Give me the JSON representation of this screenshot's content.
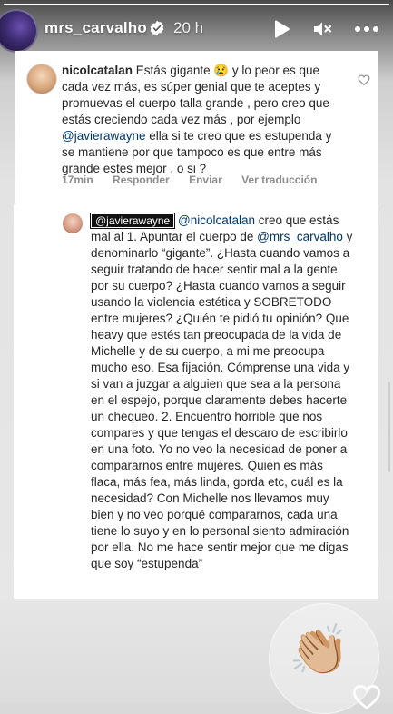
{
  "story": {
    "progress": 1.0,
    "username": "mrs_carvalho",
    "time": "20 h",
    "icons": [
      "verified-badge-icon",
      "play-icon",
      "mute-icon",
      "more-icon"
    ]
  },
  "comment": {
    "author": "nicolcatalan",
    "text": "Estás gigante 😢 y lo peor es que cada vez más, es súper genial que te aceptes y promuevas el cuerpo talla grande , pero creo que estás creciendo cada vez más , por ejemplo",
    "mention": "@javierawayne",
    "text_after": "ella si te creo que es estupenda y se mantiene por que tampoco es que entre más grande estés mejor , o si ?",
    "time": "17min",
    "reply_label": "Responder",
    "send_label": "Enviar",
    "translate_label": "Ver traducción"
  },
  "reply": {
    "tag": "@javierawayne",
    "mention1": "@nicolcatalan",
    "text1": "creo que estás mal al 1. Apuntar el cuerpo de",
    "mention2": "@mrs_carvalho",
    "text2": "y denominarlo “gigante”. ¿Hasta cuando vamos a seguir tratando de hacer sentir mal a la gente por su cuerpo? ¿Hasta cuando vamos a seguir usando la violencia estética y SOBRETODO entre mujeres? ¿Quién te pidió tu opinión? Que heavy que estés tan preocupada de la vida de Michelle y de su cuerpo, a mi me preocupa mucho eso. Esa fijación. Cómprense una vida y si van a juzgar a alguien que sea a la persona en el espejo, porque claramente debes hacerte un chequeo. 2. Encuentro horrible que nos compares y que tengas el descaro de escribirlo en una foto. Yo no veo la necesidad de poner a compararnos entre mujeres. Quien es más flaca, más fea, más linda, gorda etc, cuál es la necesidad? Con Michelle nos llevamos muy bien y no veo porqué compararnos, cada una tiene lo suyo y en lo personal siento admiración por ella. No me hace sentir mejor que me digas que soy “estupenda”"
  },
  "reaction": {
    "emoji": "👏🏼"
  },
  "colors": {
    "mention": "#00376b",
    "text": "#262626",
    "meta": "#8e8e8e"
  }
}
